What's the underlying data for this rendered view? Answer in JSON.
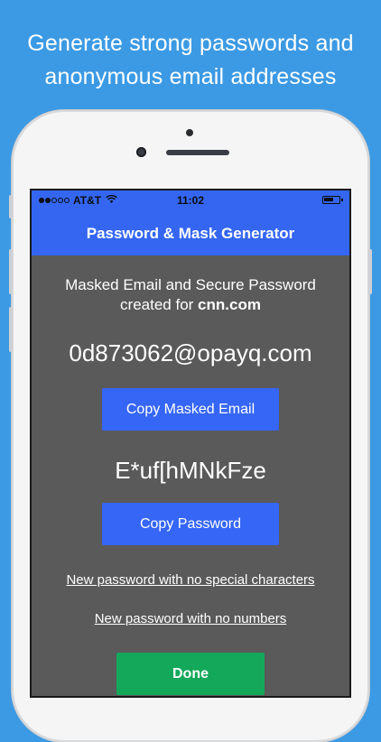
{
  "headline": {
    "line1": "Generate strong passwords and",
    "line2": "anonymous email addresses"
  },
  "status_bar": {
    "carrier": "AT&T",
    "time": "11:02",
    "wifi_icon": "wifi-icon",
    "battery_icon": "battery-icon"
  },
  "navbar": {
    "title": "Password & Mask Generator"
  },
  "main": {
    "intro_line1": "Masked Email and Secure Password",
    "intro_prefix": "created for ",
    "site": "cnn.com",
    "masked_email": "0d873062@opayq.com",
    "copy_email_label": "Copy Masked Email",
    "password": "E*uf[hMNkFze",
    "copy_password_label": "Copy Password",
    "link_no_special": "New password with no special characters",
    "link_no_numbers": "New password with no numbers",
    "done_label": "Done"
  },
  "colors": {
    "background": "#3c9ae4",
    "nav": "#3466f2",
    "screen": "#5a5a5a",
    "button": "#3566f6",
    "done": "#14a85a"
  }
}
